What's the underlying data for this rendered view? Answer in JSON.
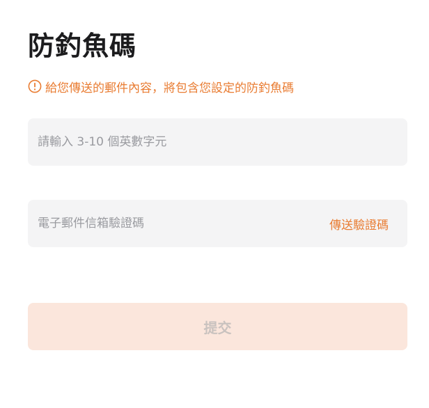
{
  "page": {
    "title": "防釣魚碼"
  },
  "hint": {
    "icon": "warning-circle-icon",
    "text": "給您傳送的郵件內容，將包含您設定的防釣魚碼"
  },
  "form": {
    "anti_phishing_code": {
      "value": "",
      "placeholder": "請輸入 3-10 個英數字元"
    },
    "email_verification": {
      "value": "",
      "placeholder": "電子郵件信箱驗證碼",
      "send_code_label": "傳送驗證碼"
    },
    "submit_label": "提交"
  },
  "colors": {
    "accent": "#e97c32",
    "title": "#1c1c1e",
    "field_background": "#f4f4f5",
    "placeholder": "#9a9ba0",
    "submit_background_disabled": "#fbe6dc",
    "submit_text_disabled": "#c9c2bf"
  }
}
